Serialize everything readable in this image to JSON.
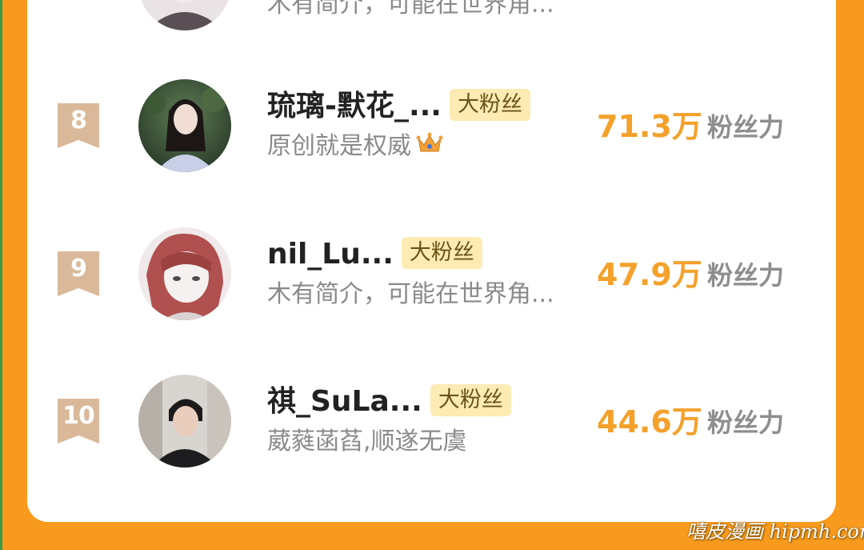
{
  "rows": [
    {
      "rank": "",
      "name": "",
      "badge": "",
      "bio": "木有简介，可能在世界角...",
      "score": "",
      "score_label": ""
    },
    {
      "rank": "8",
      "name": "琉璃-默花_...",
      "badge": "大粉丝",
      "bio": "原创就是权威",
      "bio_icon": "crown-icon",
      "score": "71.3万",
      "score_label": "粉丝力"
    },
    {
      "rank": "9",
      "name": "nil_Lu...",
      "badge": "大粉丝",
      "bio": "木有简介，可能在世界角...",
      "score": "47.9万",
      "score_label": "粉丝力"
    },
    {
      "rank": "10",
      "name": "祺_SuLa...",
      "badge": "大粉丝",
      "bio": "葳蕤菡萏,顺遂无虞",
      "score": "44.6万",
      "score_label": "粉丝力"
    }
  ],
  "watermark": "嘻皮漫画 hipmh.com",
  "colors": {
    "background": "#F79A1D",
    "score": "#F4A12B",
    "badge_bg": "#FCEBB2",
    "rank_ribbon": "#D9B99A"
  }
}
